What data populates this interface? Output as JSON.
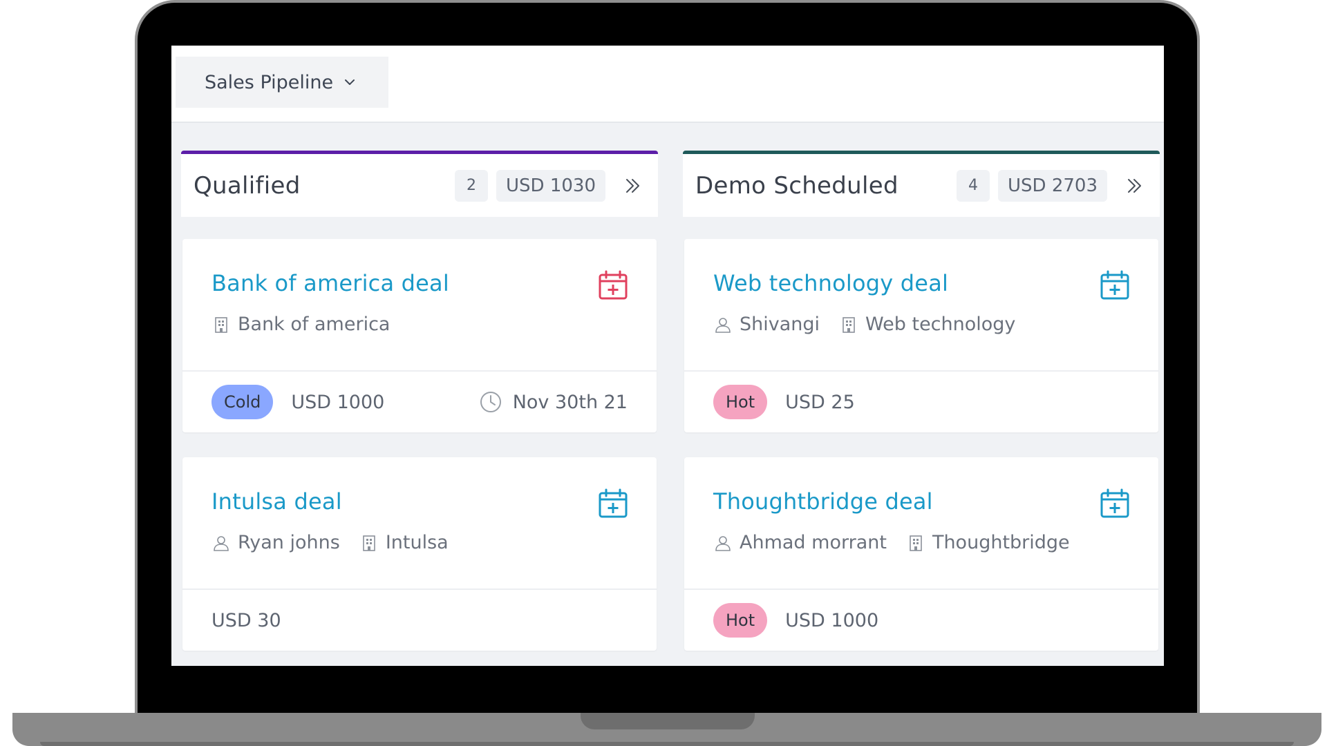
{
  "header": {
    "pipeline_label": "Sales Pipeline"
  },
  "colors": {
    "qualified_accent": "#5c1ea8",
    "demo_accent": "#1f5a5a",
    "deal_title": "#1a99c8",
    "cal_red": "#e0405e",
    "cal_blue": "#1a99c8",
    "cold_pill": "#8aa7ff",
    "hot_pill": "#f5a3c0"
  },
  "columns": [
    {
      "title": "Qualified",
      "count": "2",
      "amount": "USD 1030",
      "cards": [
        {
          "title": "Bank of america deal",
          "calendar_icon": "calendar-plus-icon",
          "calendar_color": "red",
          "contact": "",
          "company": "Bank of america",
          "temperature": "Cold",
          "amount": "USD 1000",
          "date": "Nov 30th 21"
        },
        {
          "title": "Intulsa deal",
          "calendar_icon": "calendar-plus-icon",
          "calendar_color": "blue",
          "contact": "Ryan johns",
          "company": "Intulsa",
          "temperature": "",
          "amount": "USD 30",
          "date": ""
        }
      ]
    },
    {
      "title": "Demo Scheduled",
      "count": "4",
      "amount": "USD 2703",
      "cards": [
        {
          "title": "Web technology deal",
          "calendar_icon": "calendar-plus-icon",
          "calendar_color": "blue",
          "contact": "Shivangi",
          "company": "Web technology",
          "temperature": "Hot",
          "amount": "USD 25",
          "date": ""
        },
        {
          "title": "Thoughtbridge deal",
          "calendar_icon": "calendar-plus-icon",
          "calendar_color": "blue",
          "contact": "Ahmad morrant",
          "company": "Thoughtbridge",
          "temperature": "Hot",
          "amount": "USD 1000",
          "date": ""
        }
      ]
    }
  ]
}
